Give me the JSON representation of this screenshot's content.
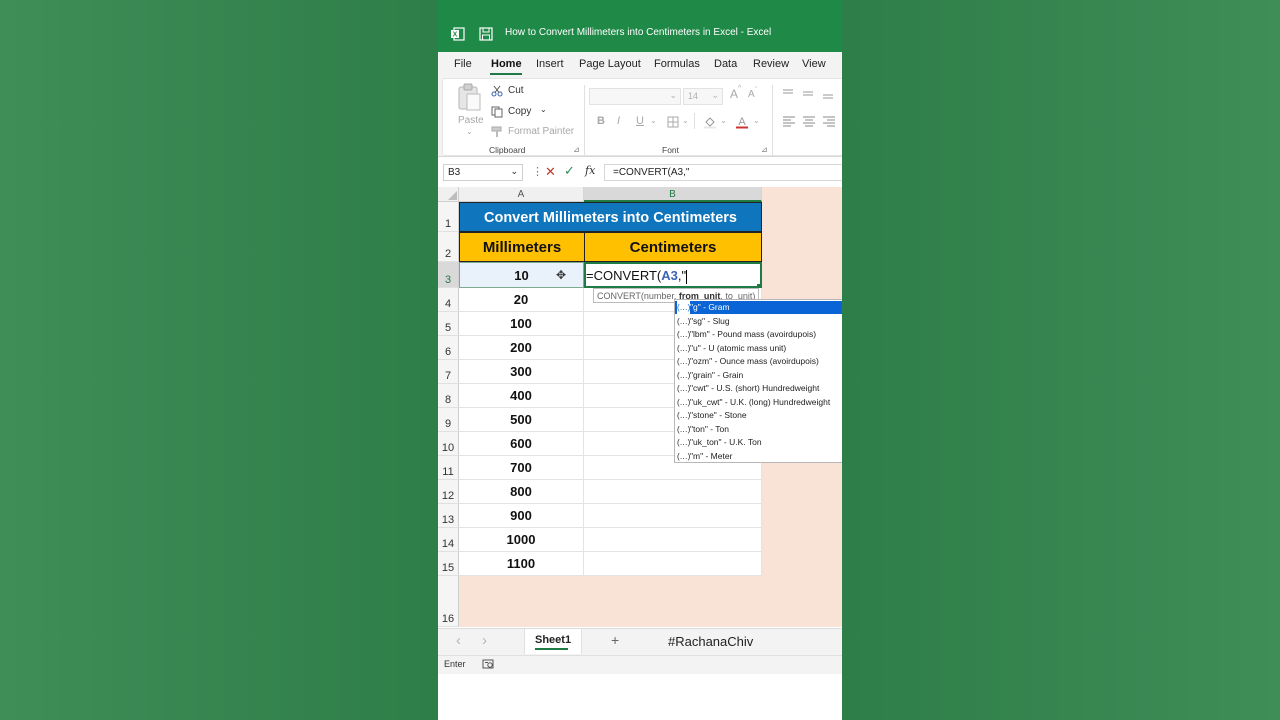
{
  "window": {
    "title": "How to Convert Millimeters into Centimeters in Excel  -  Excel"
  },
  "menu": {
    "items": [
      "File",
      "Home",
      "Insert",
      "Page Layout",
      "Formulas",
      "Data",
      "Review",
      "View"
    ],
    "active": "Home"
  },
  "ribbon": {
    "clipboard": {
      "paste": "Paste",
      "cut": "Cut",
      "copy": "Copy",
      "format_painter": "Format Painter",
      "group": "Clipboard"
    },
    "font": {
      "font_size": "14",
      "bold": "B",
      "italic": "I",
      "underline": "U",
      "grow": "A",
      "shrink": "A",
      "group": "Font"
    }
  },
  "formula_bar": {
    "name_box": "B3",
    "fx": "fx",
    "formula": "=CONVERT(A3,\""
  },
  "sheet": {
    "columns": [
      "A",
      "B"
    ],
    "rows": [
      "1",
      "2",
      "3",
      "4",
      "5",
      "6",
      "7",
      "8",
      "9",
      "10",
      "11",
      "12",
      "13",
      "14",
      "15",
      "16"
    ],
    "title": "Convert Millimeters into Centimeters",
    "headers": [
      "Millimeters",
      "Centimeters"
    ],
    "millimeters": [
      "10",
      "20",
      "100",
      "200",
      "300",
      "400",
      "500",
      "600",
      "700",
      "800",
      "900",
      "1000",
      "1100"
    ],
    "editing": {
      "prefix": "=CONVERT(",
      "ref": "A3",
      "suffix": ",\""
    }
  },
  "tooltip": {
    "prefix": "CONVERT(number, ",
    "bold": "from_unit",
    "suffix": ", to_unit)"
  },
  "autocomplete": [
    "\"g\" - Gram",
    "\"sg\" - Slug",
    "\"lbm\" - Pound mass (avoirdupois)",
    "\"u\" - U (atomic mass unit)",
    "\"ozm\" - Ounce mass (avoirdupois)",
    "\"grain\" - Grain",
    "\"cwt\" - U.S. (short) Hundredweight",
    "\"uk_cwt\" - U.K. (long) Hundredweight",
    "\"stone\" - Stone",
    "\"ton\" - Ton",
    "\"uk_ton\" - U.K. Ton",
    "\"m\" - Meter"
  ],
  "autocomplete_icon": "(…)",
  "sheet_tabs": {
    "active": "Sheet1",
    "add": "+",
    "watermark": "#RachanaChiv",
    "prev": "‹",
    "next": "›"
  },
  "status": {
    "mode": "Enter"
  },
  "colors": {
    "excel_green": "#1f8a47",
    "title_blue": "#0f75bc",
    "header_gold": "#ffc000",
    "selection_blue": "#0a64d6",
    "ref_blue": "#3b63b8"
  }
}
